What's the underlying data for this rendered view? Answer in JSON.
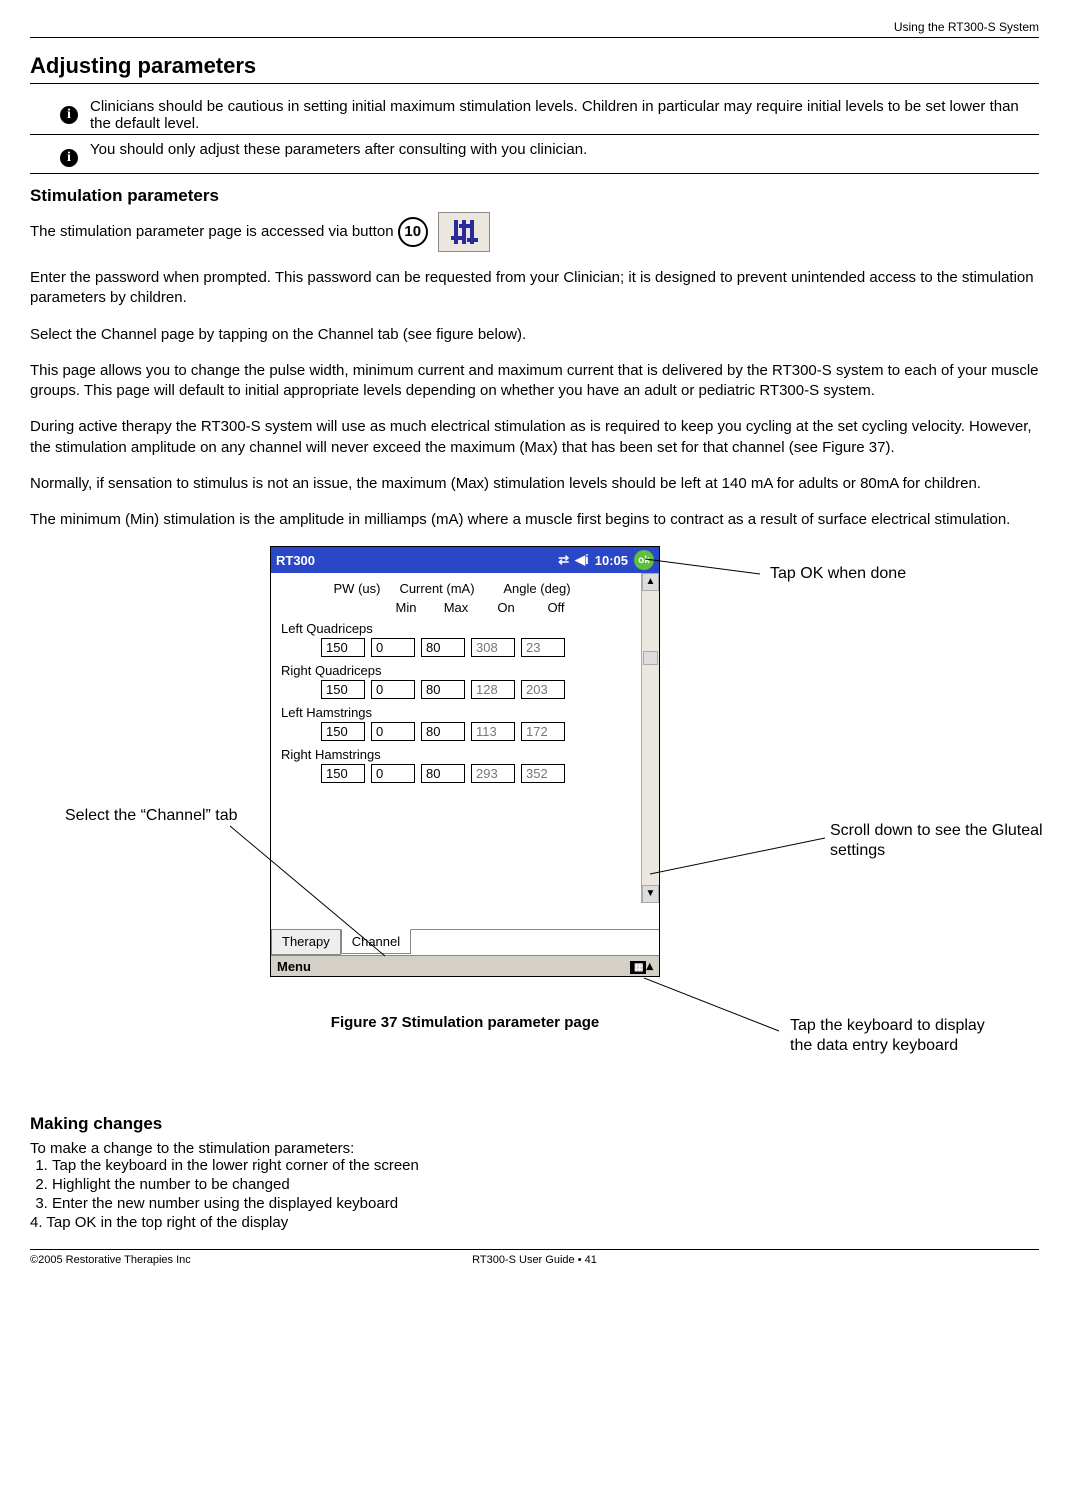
{
  "header": {
    "right": "Using the RT300-S System"
  },
  "title": "Adjusting parameters",
  "info": [
    "Clinicians should be cautious in setting initial maximum stimulation levels.  Children in particular may require initial levels to be set lower than the default level.",
    "You should only adjust these parameters after consulting with you clinician."
  ],
  "section1_title": "Stimulation parameters",
  "stim_line": "The stimulation parameter page is accessed via button",
  "button_num": "10",
  "paras": [
    "Enter the password when prompted.  This password can be requested from your Clinician; it is designed to prevent unintended access to the stimulation parameters by children.",
    "Select the Channel page by tapping on the Channel tab (see figure below).",
    "This page allows you to change the pulse width, minimum current and maximum current that is delivered by the RT300-S system to each of your muscle groups.  This page will default to initial appropriate levels depending on whether you have an adult or pediatric RT300-S system.",
    "During active therapy the RT300-S system will use as much electrical stimulation as is required to keep you cycling at the set cycling velocity.  However, the stimulation amplitude on any channel will never exceed the maximum (Max) that has been set for that channel (see Figure 37).",
    "Normally, if sensation to stimulus is not an issue, the maximum (Max) stimulation levels should be left at 140 mA for adults or 80mA for children.",
    "The  minimum (Min) stimulation is the amplitude in milliamps (mA) where a muscle first begins to contract as a result of surface electrical stimulation."
  ],
  "figure": {
    "app_title": "RT300",
    "time": "10:05",
    "ok": "ok",
    "col1": "PW (us)",
    "col2": "Current (mA)",
    "col3": "Angle (deg)",
    "sub_min": "Min",
    "sub_max": "Max",
    "sub_on": "On",
    "sub_off": "Off",
    "rows": [
      {
        "name": "Left Quadriceps",
        "pw": "150",
        "min": "0",
        "max": "80",
        "on": "308",
        "off": "23"
      },
      {
        "name": "Right Quadriceps",
        "pw": "150",
        "min": "0",
        "max": "80",
        "on": "128",
        "off": "203"
      },
      {
        "name": "Left Hamstrings",
        "pw": "150",
        "min": "0",
        "max": "80",
        "on": "113",
        "off": "172"
      },
      {
        "name": "Right Hamstrings",
        "pw": "150",
        "min": "0",
        "max": "80",
        "on": "293",
        "off": "352"
      }
    ],
    "tab_therapy": "Therapy",
    "tab_channel": "Channel",
    "menu": "Menu",
    "caption": "Figure 37 Stimulation parameter page"
  },
  "callouts": {
    "ok": "Tap OK when done",
    "channel": "Select the “Channel” tab",
    "scroll": "Scroll down to see the Gluteal settings",
    "keyboard": "Tap the keyboard to display the data entry keyboard"
  },
  "section2_title": "Making changes",
  "changes_intro": "To  make a change to the stimulation parameters:",
  "steps": [
    "Tap the keyboard in the lower right corner of the screen",
    "Highlight the number to be changed",
    "Enter the new number using the displayed keyboard",
    "4.  Tap OK in the top right of the display"
  ],
  "footer": {
    "left": "©2005 Restorative Therapies Inc",
    "center": "RT300-S User Guide • 41"
  }
}
